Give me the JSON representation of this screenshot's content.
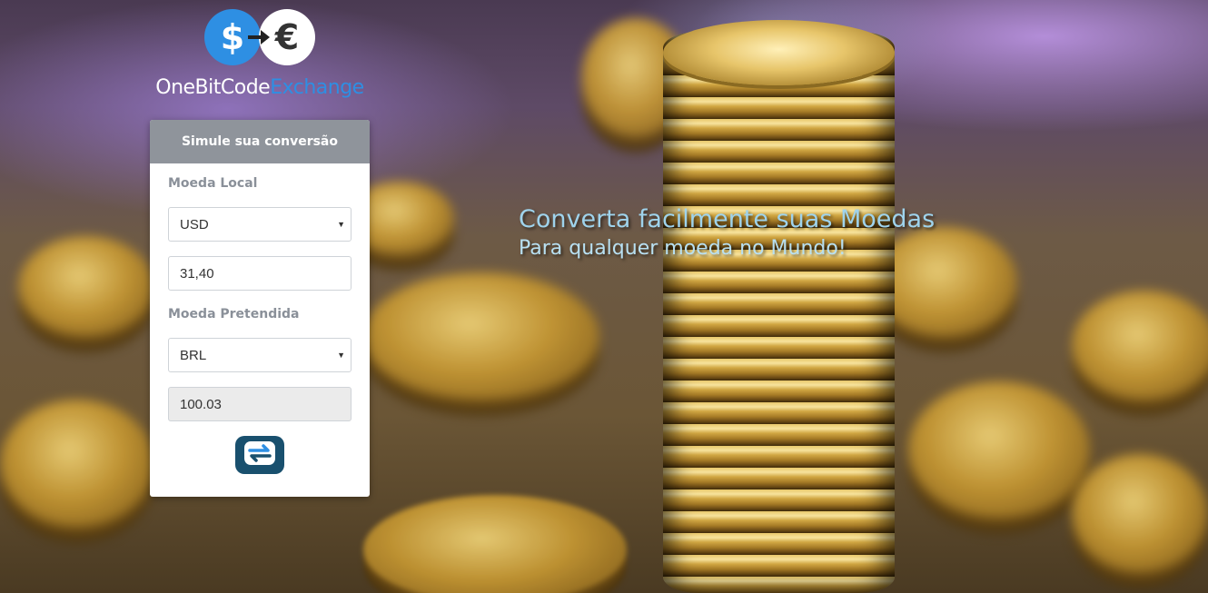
{
  "brand": {
    "name_part1": "OneBitCode",
    "name_part2": "Exchange",
    "accent_color": "#2e8fe3"
  },
  "icons": {
    "logo_left": "dollar-coin-icon",
    "logo_right": "euro-coin-icon",
    "exchange": "exchange-arrows-icon",
    "dropdown": "caret-down-icon"
  },
  "converter": {
    "header": "Simule sua conversão",
    "local_label": "Moeda Local",
    "local_currency": "USD",
    "amount": "31,40",
    "target_label": "Moeda Pretendida",
    "target_currency": "BRL",
    "result": "100.03"
  },
  "hero": {
    "title": "Converta facilmente suas Moedas",
    "subtitle": "Para qualquer moeda no Mundo!"
  }
}
